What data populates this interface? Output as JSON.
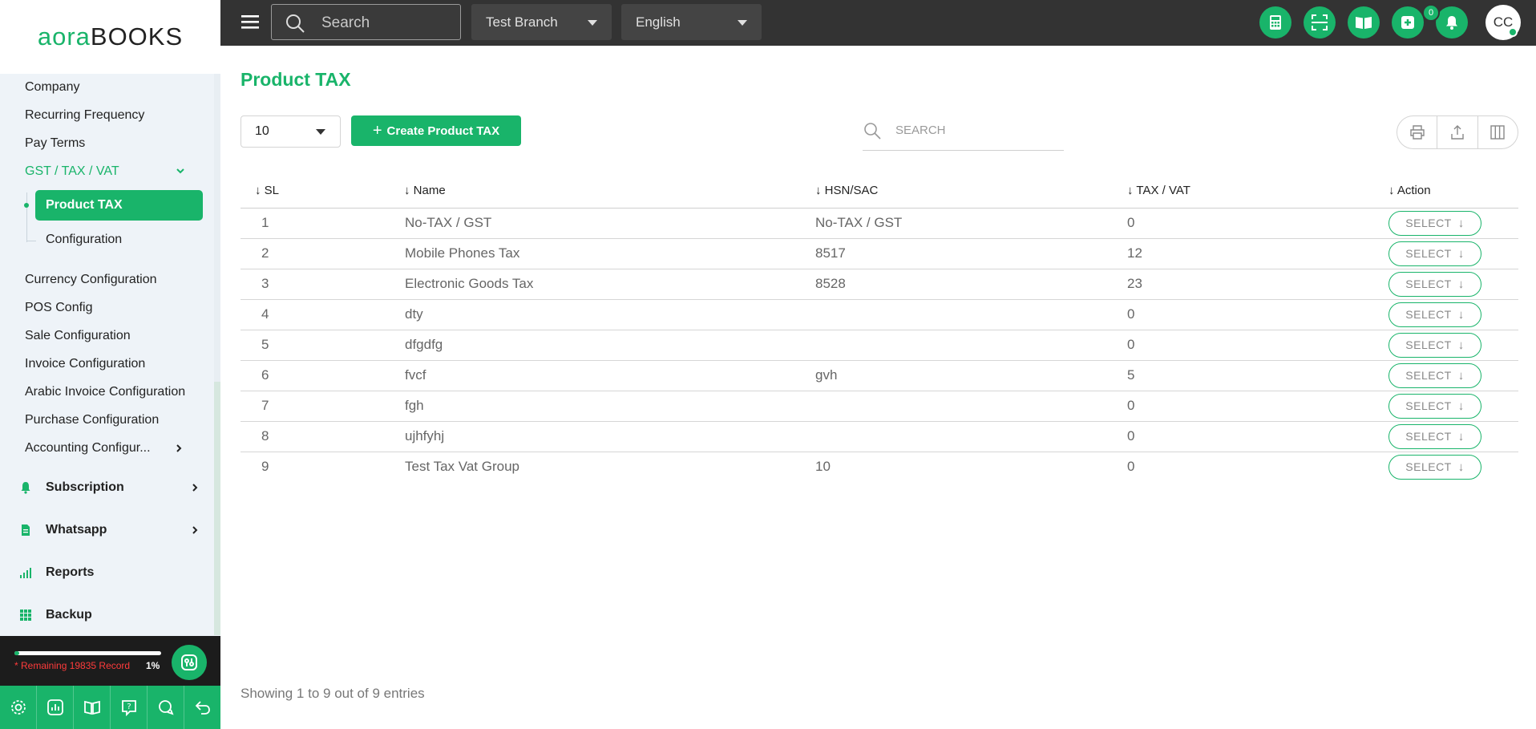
{
  "brand": {
    "logo_part1": "aora",
    "logo_part2": "BOOKS"
  },
  "sidebar": {
    "items": [
      {
        "label": "Company"
      },
      {
        "label": "Recurring Frequency"
      },
      {
        "label": "Pay Terms"
      },
      {
        "label": "GST / TAX / VAT"
      },
      {
        "label": "Currency Configuration"
      },
      {
        "label": "POS Config"
      },
      {
        "label": "Sale Configuration"
      },
      {
        "label": "Invoice Configuration"
      },
      {
        "label": "Arabic Invoice Configuration"
      },
      {
        "label": "Purchase Configuration"
      },
      {
        "label": "Accounting Configur..."
      }
    ],
    "sub_items": [
      {
        "label": "Product TAX"
      },
      {
        "label": "Configuration"
      }
    ],
    "main_items": [
      {
        "label": "Subscription",
        "icon": "bell-icon"
      },
      {
        "label": "Whatsapp",
        "icon": "document-icon"
      },
      {
        "label": "Reports",
        "icon": "bar-chart-icon"
      },
      {
        "label": "Backup",
        "icon": "grid-icon"
      }
    ],
    "remaining": "* Remaining 19835 Record",
    "usage_percent": "1%",
    "usage_value": 1
  },
  "topbar": {
    "search_placeholder": "Search",
    "branch": "Test Branch",
    "language": "English",
    "notification_count": "0",
    "avatar_initials": "CC"
  },
  "page": {
    "title": "Product TAX",
    "page_size": "10",
    "create_button": "Create Product TAX",
    "search_placeholder": "SEARCH",
    "footer": "Showing 1 to 9 out of 9 entries"
  },
  "table": {
    "headers": [
      "SL",
      "Name",
      "HSN/SAC",
      "TAX / VAT",
      "Action"
    ],
    "action_label": "SELECT",
    "rows": [
      {
        "sl": "1",
        "name": "No-TAX / GST",
        "hsn": "No-TAX / GST",
        "tax": "0"
      },
      {
        "sl": "2",
        "name": "Mobile Phones Tax",
        "hsn": "8517",
        "tax": "12"
      },
      {
        "sl": "3",
        "name": "Electronic Goods Tax",
        "hsn": "8528",
        "tax": "23"
      },
      {
        "sl": "4",
        "name": "dty",
        "hsn": "",
        "tax": "0"
      },
      {
        "sl": "5",
        "name": "dfgdfg",
        "hsn": "",
        "tax": "0"
      },
      {
        "sl": "6",
        "name": "fvcf",
        "hsn": "gvh",
        "tax": "5"
      },
      {
        "sl": "7",
        "name": "fgh",
        "hsn": "",
        "tax": "0"
      },
      {
        "sl": "8",
        "name": "ujhfyhj",
        "hsn": "",
        "tax": "0"
      },
      {
        "sl": "9",
        "name": "Test Tax Vat Group",
        "hsn": "10",
        "tax": "0"
      }
    ]
  },
  "colors": {
    "accent": "#19b46a",
    "topbar": "#333333",
    "sidebar": "#eef3f8"
  }
}
